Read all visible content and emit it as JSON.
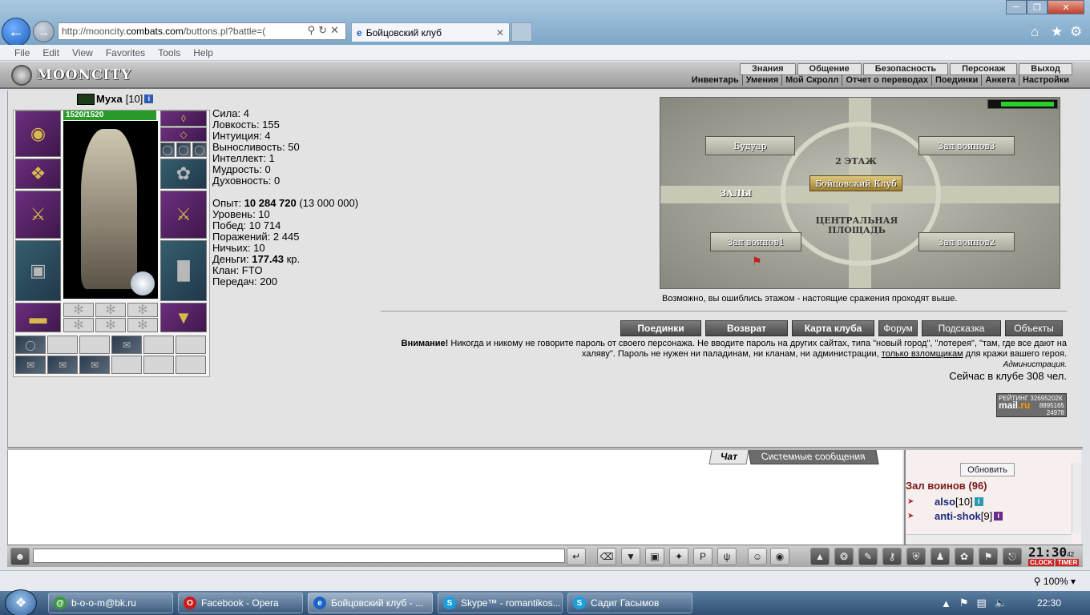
{
  "browser": {
    "url_prefix": "http://mooncity.",
    "url_domain": "combats.com",
    "url_suffix": "/buttons.pl?battle=(",
    "tab_title": "Бойцовский клуб",
    "menu": [
      "File",
      "Edit",
      "View",
      "Favorites",
      "Tools",
      "Help"
    ],
    "zoom": "100%"
  },
  "game": {
    "logo": "MOONCITY",
    "top_menu": [
      "Знания",
      "Общение",
      "Безопасность",
      "Персонаж",
      "Выход"
    ],
    "sub_menu": [
      "Инвентарь",
      "Умения",
      "Мой Скролл",
      "Отчет о переводах",
      "Поединки",
      "Анкета",
      "Настройки"
    ]
  },
  "character": {
    "name": "Муха",
    "level": "[10]",
    "hp": "1520/1520",
    "stats": [
      "Сила: 4",
      "Ловкость: 155",
      "Интуиция: 4",
      "Выносливость: 50",
      "Интеллект: 1",
      "Мудрость: 0",
      "Духовность: 0"
    ],
    "exp_label": "Опыт: ",
    "exp_value": "10 284 720",
    "exp_next": " (13 000 000)",
    "level_line": "Уровень: 10",
    "wins": "Побед: 10 714",
    "losses": "Поражений: 2 445",
    "draws": "Ничьих: 10",
    "money_label": "Деньги: ",
    "money_value": "177.43",
    "money_unit": " кр.",
    "clan": "Клан: FTO",
    "transfers": "Передач: 200"
  },
  "map": {
    "floor": "2 ЭТАЖ",
    "club": "Бойцовский Клуб",
    "center": "ЦЕНТРАЛЬНАЯ ПЛОЩАДЬ",
    "halls": "ЗАЛЫ",
    "rooms": [
      "Будуар",
      "Зал воинов3",
      "Зал воинов1",
      "Зал воинов2"
    ],
    "note": "Возможно, вы ошиблись этажом - настоящие сражения проходят выше."
  },
  "actions": [
    "Поединки",
    "Возврат",
    "Карта клуба",
    "Форум",
    "Подсказка",
    "Объекты"
  ],
  "warning": {
    "title": "Внимание!",
    "text1": " Никогда и никому не говорите пароль от своего персонажа. Не вводите пароль на других сайтах, типа \"новый город\", \"лотерея\", \"там, где все дают на халяву\". Пароль не нужен ни паладинам, ни кланам, ни администрации, ",
    "link": "только взломщикам",
    "text2": " для кражи вашего героя.",
    "signature": "Администрация.",
    "online": "Сейчас в клубе 308 чел."
  },
  "rating": {
    "label": "РЕЙТИНГ 32695202К",
    "mail_a": "mail",
    "mail_b": ".ru",
    "n1": "8895165",
    "n2": "24978"
  },
  "chat": {
    "tab_chat": "Чат",
    "tab_system": "Системные сообщения",
    "refresh": "Обновить",
    "room": "Зал воинов (96)",
    "users": [
      {
        "name": "also",
        "level": "[10]"
      },
      {
        "name": "anti-shok",
        "level": "[9]"
      }
    ]
  },
  "clock": {
    "time": "21:30",
    "sec": "42",
    "clock_label": "CLOCK",
    "timer_label": "TIMER"
  },
  "taskbar": {
    "tasks": [
      "b-o-o-m@bk.ru",
      "Facebook - Opera",
      "Бойцовский клуб - ...",
      "Skype™ - romantikos...",
      "Садиг Гасымов"
    ],
    "time": "22:30"
  }
}
